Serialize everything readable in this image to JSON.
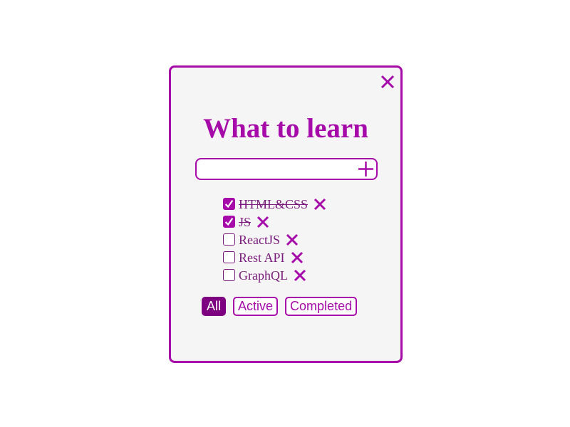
{
  "app": {
    "title": "What to learn",
    "accent_color": "#a60aa8",
    "text_color": "#7a1a7c"
  },
  "new_task": {
    "value": "",
    "add_icon": "plus-icon"
  },
  "close_icon": "close-icon",
  "todos": [
    {
      "label": "HTML&CSS",
      "completed": true
    },
    {
      "label": "JS",
      "completed": true
    },
    {
      "label": "ReactJS",
      "completed": false
    },
    {
      "label": "Rest API",
      "completed": false
    },
    {
      "label": "GraphQL",
      "completed": false
    }
  ],
  "filters": [
    {
      "label": "All",
      "active": true
    },
    {
      "label": "Active",
      "active": false
    },
    {
      "label": "Completed",
      "active": false
    }
  ]
}
